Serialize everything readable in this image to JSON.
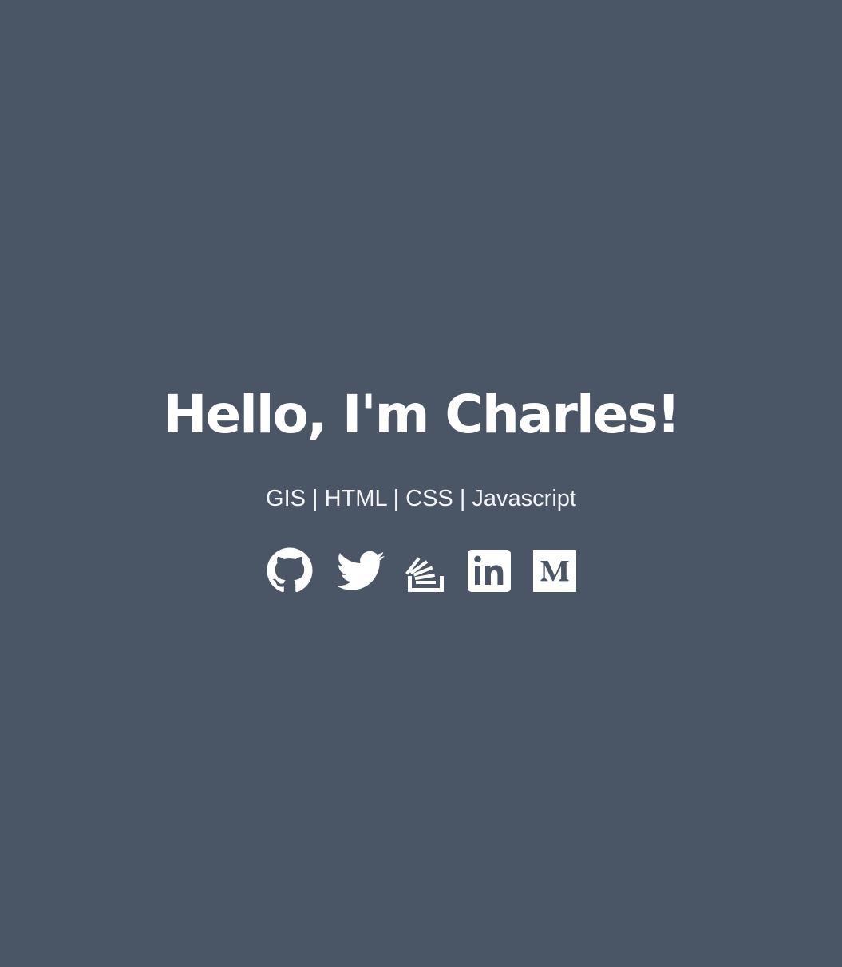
{
  "hero": {
    "title": "Hello, I'm Charles!",
    "tagline": "GIS | HTML | CSS | Javascript"
  },
  "social_links": [
    {
      "name": "GitHub",
      "icon": "github-icon"
    },
    {
      "name": "Twitter",
      "icon": "twitter-icon"
    },
    {
      "name": "Stack Overflow",
      "icon": "stackoverflow-icon"
    },
    {
      "name": "LinkedIn",
      "icon": "linkedin-icon"
    },
    {
      "name": "Medium",
      "icon": "medium-icon"
    }
  ],
  "colors": {
    "background": "#4a5666",
    "text": "#ffffff"
  }
}
